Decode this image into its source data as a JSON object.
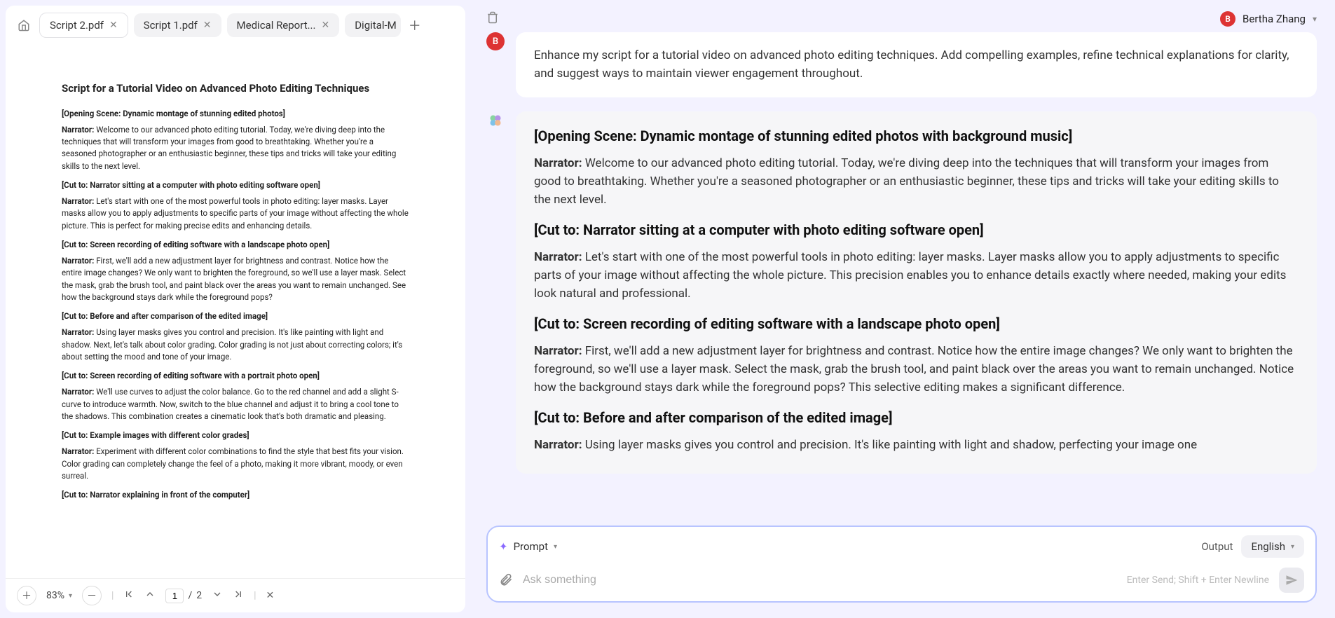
{
  "tabs": [
    {
      "label": "Script 2.pdf",
      "active": true
    },
    {
      "label": "Script 1.pdf",
      "active": false
    },
    {
      "label": "Medical Report...",
      "active": false
    },
    {
      "label": "Digital-M",
      "active": false,
      "truncated": true
    }
  ],
  "document": {
    "title": "Script for a Tutorial Video on Advanced Photo Editing Techniques",
    "blocks": [
      {
        "type": "scene",
        "text": "[Opening Scene: Dynamic montage of stunning edited photos]"
      },
      {
        "type": "narr",
        "text": "Welcome to our advanced photo editing tutorial. Today, we're diving deep into the techniques that will transform your images from good to breathtaking. Whether you're a seasoned photographer or an enthusiastic beginner, these tips and tricks will take your editing skills to the next level."
      },
      {
        "type": "scene",
        "text": "[Cut to: Narrator sitting at a computer with photo editing software open]"
      },
      {
        "type": "narr",
        "text": "Let's start with one of the most powerful tools in photo editing: layer masks. Layer masks allow you to apply adjustments to specific parts of your image without affecting the whole picture. This is perfect for making precise edits and enhancing details."
      },
      {
        "type": "scene",
        "text": "[Cut to: Screen recording of editing software with a landscape photo open]"
      },
      {
        "type": "narr",
        "text": "First, we'll add a new adjustment layer for brightness and contrast. Notice how the entire image changes? We only want to brighten the foreground, so we'll use a layer mask. Select the mask, grab the brush tool, and paint black over the areas you want to remain unchanged. See how the background stays dark while the foreground pops?"
      },
      {
        "type": "scene",
        "text": "[Cut to: Before and after comparison of the edited image]"
      },
      {
        "type": "narr",
        "text": "Using layer masks gives you control and precision. It's like painting with light and shadow. Next, let's talk about color grading. Color grading is not just about correcting colors; it's about setting the mood and tone of your image."
      },
      {
        "type": "scene",
        "text": "[Cut to: Screen recording of editing software with a portrait photo open]"
      },
      {
        "type": "narr",
        "text": "We'll use curves to adjust the color balance. Go to the red channel and add a slight S-curve to introduce warmth. Now, switch to the blue channel and adjust it to bring a cool tone to the shadows. This combination creates a cinematic look that's both dramatic and pleasing."
      },
      {
        "type": "scene",
        "text": "[Cut to: Example images with different color grades]"
      },
      {
        "type": "narr",
        "text": "Experiment with different color combinations to find the style that best fits your vision. Color grading can completely change the feel of a photo, making it more vibrant, moody, or even surreal."
      },
      {
        "type": "scene",
        "text": "[Cut to: Narrator explaining in front of the computer]"
      }
    ],
    "narrator_label": "Narrator:"
  },
  "footer": {
    "zoom": "83%",
    "page_current": "1",
    "page_sep": "/",
    "page_total": "2"
  },
  "user": {
    "initial": "B",
    "name": "Bertha Zhang"
  },
  "chat": {
    "user_msg": "Enhance my script for a tutorial video on advanced photo editing techniques. Add compelling examples, refine technical explanations for clarity, and suggest ways to maintain viewer engagement throughout.",
    "response_blocks": [
      {
        "type": "scene",
        "text": "[Opening Scene: Dynamic montage of stunning edited photos with background music]"
      },
      {
        "type": "narr",
        "text": "Welcome to our advanced photo editing tutorial. Today, we're diving deep into the techniques that will transform your images from good to breathtaking. Whether you're a seasoned photographer or an enthusiastic beginner, these tips and tricks will take your editing skills to the next level."
      },
      {
        "type": "scene",
        "text": "[Cut to: Narrator sitting at a computer with photo editing software open]"
      },
      {
        "type": "narr",
        "text": "Let's start with one of the most powerful tools in photo editing: layer masks. Layer masks allow you to apply adjustments to specific parts of your image without affecting the whole picture. This precision enables you to enhance details exactly where needed, making your edits look natural and professional."
      },
      {
        "type": "scene",
        "text": "[Cut to: Screen recording of editing software with a landscape photo open]"
      },
      {
        "type": "narr",
        "text": "First, we'll add a new adjustment layer for brightness and contrast. Notice how the entire image changes? We only want to brighten the foreground, so we'll use a layer mask. Select the mask, grab the brush tool, and paint black over the areas you want to remain unchanged. Notice how the background stays dark while the foreground pops? This selective editing makes a significant difference."
      },
      {
        "type": "scene",
        "text": "[Cut to: Before and after comparison of the edited image]"
      },
      {
        "type": "narr",
        "text": "Using layer masks gives you control and precision. It's like painting with light and shadow, perfecting your image one"
      }
    ],
    "narrator_label": "Narrator:"
  },
  "composer": {
    "prompt_label": "Prompt",
    "output_label": "Output",
    "language": "English",
    "placeholder": "Ask something",
    "hint": "Enter Send; Shift + Enter Newline"
  }
}
